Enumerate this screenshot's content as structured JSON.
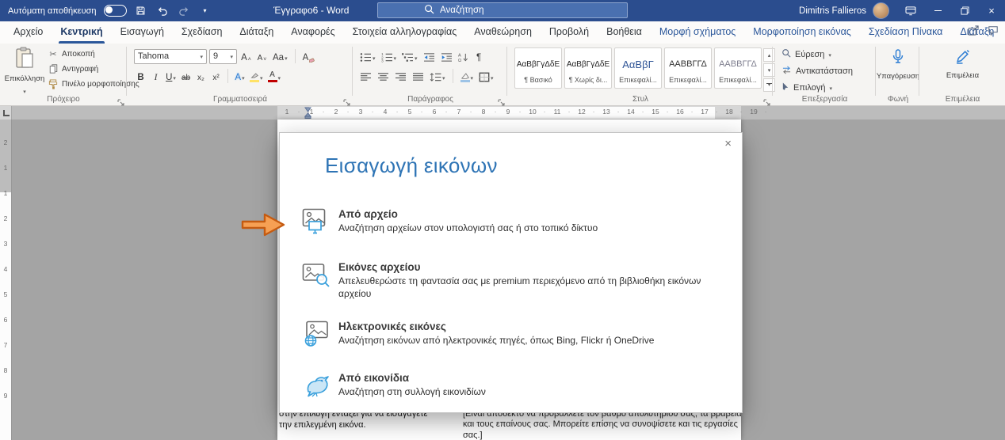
{
  "colors": {
    "titlebar": "#2b4d8e",
    "accent": "#2b579a",
    "contextual-tab": "#2b579a",
    "dialog-title": "#2E74B5",
    "annotation-arrow": "#ED7D31",
    "heading-sample": "#2F5496",
    "font-color-bar": "#c00000",
    "highlight-bar": "#ffe266"
  },
  "titlebar": {
    "autosave_label": "Αυτόματη αποθήκευση",
    "document_title": "Έγγραφο6 - Word",
    "search_placeholder": "Αναζήτηση",
    "user_name": "Dimitris Fallieros"
  },
  "tabs": {
    "items": [
      {
        "label": "Αρχείο"
      },
      {
        "label": "Κεντρική"
      },
      {
        "label": "Εισαγωγή"
      },
      {
        "label": "Σχεδίαση"
      },
      {
        "label": "Διάταξη"
      },
      {
        "label": "Αναφορές"
      },
      {
        "label": "Στοιχεία αλληλογραφίας"
      },
      {
        "label": "Αναθεώρηση"
      },
      {
        "label": "Προβολή"
      },
      {
        "label": "Βοήθεια"
      },
      {
        "label": "Μορφή σχήματος"
      },
      {
        "label": "Μορφοποίηση εικόνας"
      },
      {
        "label": "Σχεδίαση Πίνακα"
      },
      {
        "label": "Διάταξη"
      }
    ]
  },
  "ribbon": {
    "clipboard": {
      "group_label": "Πρόχειρο",
      "paste_label": "Επικόλληση",
      "cut_label": "Αποκοπή",
      "copy_label": "Αντιγραφή",
      "format_painter_label": "Πινέλο μορφοποίησης"
    },
    "font": {
      "group_label": "Γραμματοσειρά",
      "font_name": "Tahoma",
      "font_size": "9",
      "grow": "A",
      "shrink": "A",
      "change_case": "Aa",
      "clear": "A",
      "bold": "B",
      "italic": "I",
      "underline": "U",
      "strikethrough": "ab",
      "subscript": "x₂",
      "superscript": "x²",
      "text_effects": "A",
      "font_color": "A"
    },
    "paragraph": {
      "group_label": "Παράγραφος",
      "pilcrow": "¶"
    },
    "styles": {
      "group_label": "Στυλ",
      "items": [
        {
          "sample": "ΑαΒβΓγΔδΕ",
          "label": "¶ Βασικό"
        },
        {
          "sample": "ΑαΒβΓγΔδΕ",
          "label": "¶ Χωρίς δι..."
        },
        {
          "sample": "ΑαΒβΓ",
          "label": "Επικεφαλί..."
        },
        {
          "sample": "ΑΑΒΒΓΓΔ",
          "label": "Επικεφαλί..."
        },
        {
          "sample": "ΑΑΒΒΓΓΔ",
          "label": "Επικεφαλί..."
        }
      ]
    },
    "editing": {
      "group_label": "Επεξεργασία",
      "find_label": "Εύρεση",
      "replace_label": "Αντικατάσταση",
      "select_label": "Επιλογή"
    },
    "voice": {
      "group_label": "Φωνή",
      "dictate_label": "Υπαγόρευση"
    },
    "editor": {
      "group_label": "Επιμέλεια",
      "editor_label": "Επιμέλεια"
    }
  },
  "dialog": {
    "title": "Εισαγωγή εικόνων",
    "options": [
      {
        "label": "Από αρχείο",
        "description": "Αναζήτηση αρχείων στον υπολογιστή σας ή στο τοπικό δίκτυο"
      },
      {
        "label": "Εικόνες αρχείου",
        "description": "Απελευθερώστε τη φαντασία σας με premium περιεχόμενο από τη βιβλιοθήκη εικόνων αρχείου"
      },
      {
        "label": "Ηλεκτρονικές εικόνες",
        "description": "Αναζήτηση εικόνων από ηλεκτρονικές πηγές, όπως Bing, Flickr ή OneDrive"
      },
      {
        "label": "Από εικονίδια",
        "description": "Αναζήτηση στη συλλογή εικονιδίων"
      }
    ]
  },
  "document": {
    "left_column": "στην επιλογή  εντάξει  για να εισαγάγετε την επιλεγμένη εικόνα.",
    "right_column": "[Είναι αποδεκτό να προβάλλετε τον βαθμό απολυτηρίου σας, τα βραβεία και τους επαίνους σας. Μπορείτε επίσης να συνοψίσετε και τις εργασίες σας.]"
  },
  "ruler": {
    "horizontal": [
      "1",
      "1",
      "2",
      "3",
      "4",
      "5",
      "6",
      "7",
      "8",
      "9",
      "10",
      "11",
      "12",
      "13",
      "14",
      "15",
      "16",
      "17",
      "18",
      "19"
    ],
    "vertical": [
      "2",
      "1",
      "1",
      "2",
      "3",
      "4",
      "5",
      "6",
      "7",
      "8",
      "9"
    ]
  }
}
